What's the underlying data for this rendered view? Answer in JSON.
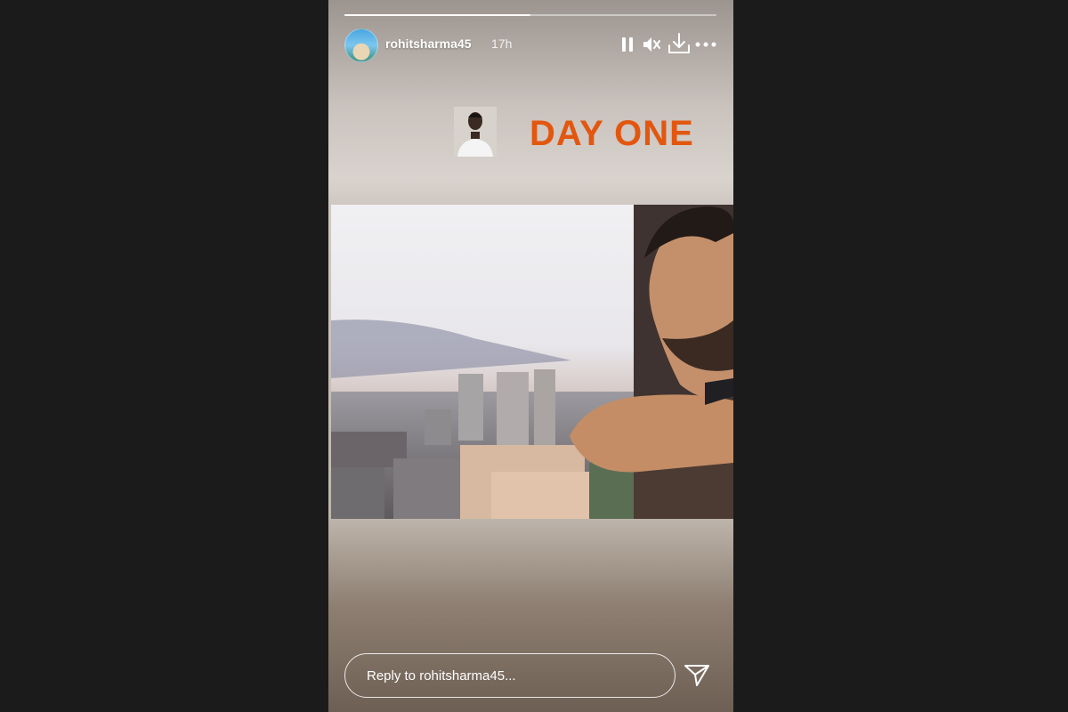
{
  "story": {
    "progress_fraction": 0.5,
    "username": "rohitsharma45",
    "time_ago": "17h",
    "headline": "DAY ONE",
    "headline_color": "#e2570f",
    "reply_placeholder": "Reply to rohitsharma45...",
    "icons": {
      "pause": "pause-icon",
      "mute": "mute-icon",
      "download": "download-icon",
      "more": "more-icon",
      "send": "send-icon"
    }
  }
}
